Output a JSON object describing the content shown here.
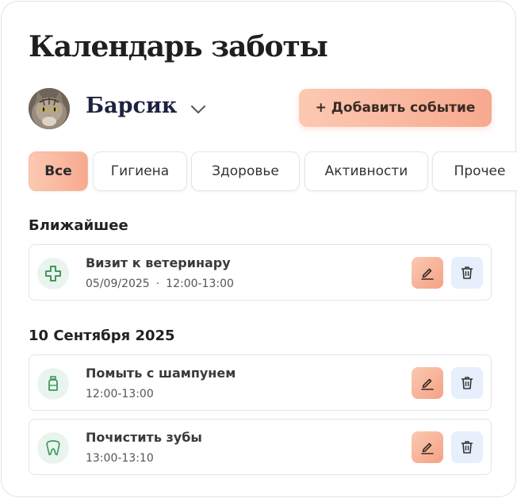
{
  "header": {
    "title": "Календарь заботы"
  },
  "pet": {
    "name": "Барсик",
    "avatar_icon": "cat-photo",
    "dropdown_icon": "chevron-down-icon"
  },
  "actions": {
    "add_event_label": "+ Добавить событие"
  },
  "tabs": [
    {
      "label": "Все",
      "active": true
    },
    {
      "label": "Гигиена",
      "active": false
    },
    {
      "label": "Здоровье",
      "active": false
    },
    {
      "label": "Активности",
      "active": false
    },
    {
      "label": "Прочее",
      "active": false
    }
  ],
  "sections": [
    {
      "label": "Ближайшее",
      "events": [
        {
          "title": "Визит к ветеринару",
          "date": "05/09/2025",
          "separator": "·",
          "time": "12:00-13:00",
          "icon": "medical-cross-icon"
        }
      ]
    },
    {
      "label": "10 Сентября 2025",
      "events": [
        {
          "title": "Помыть с шампунем",
          "time": "12:00-13:00",
          "icon": "shampoo-bottle-icon"
        },
        {
          "title": "Почистить зубы",
          "time": "13:00-13:10",
          "icon": "tooth-icon"
        }
      ]
    }
  ],
  "colors": {
    "accent_gradient_start": "#fcc9b2",
    "accent_gradient_end": "#f7a98f",
    "icon_green": "#3f9a5d",
    "delete_bg": "#e7eefc"
  }
}
